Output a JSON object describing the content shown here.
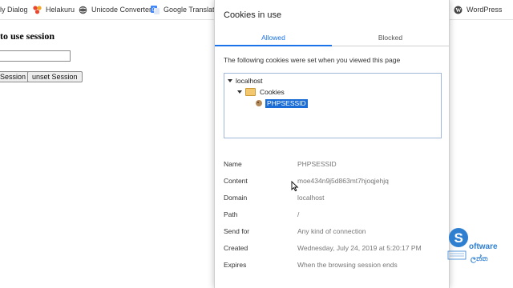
{
  "bookmarks": {
    "items": [
      {
        "label": "ly Dialog"
      },
      {
        "label": "Helakuru"
      },
      {
        "label": "Unicode Converter"
      },
      {
        "label": "Google Translate"
      }
    ],
    "right_item": {
      "label": "WordPress"
    }
  },
  "page": {
    "heading": "to use session",
    "input_value": "",
    "buttons": [
      "Session",
      "unset Session"
    ]
  },
  "dialog": {
    "title": "Cookies in use",
    "tabs": [
      "Allowed",
      "Blocked"
    ],
    "active_tab": "Allowed",
    "intro": "The following cookies were set when you viewed this page",
    "tree": {
      "root": "localhost",
      "folder": "Cookies",
      "cookie": "PHPSESSID"
    },
    "details": [
      {
        "label": "Name",
        "value": "PHPSESSID"
      },
      {
        "label": "Content",
        "value": "moe434n9j5d863mt7hjoqjehjq"
      },
      {
        "label": "Domain",
        "value": "localhost"
      },
      {
        "label": "Path",
        "value": "/"
      },
      {
        "label": "Send for",
        "value": "Any kind of connection"
      },
      {
        "label": "Created",
        "value": "Wednesday, July 24, 2019 at 5:20:17 PM"
      },
      {
        "label": "Expires",
        "value": "When the browsing session ends"
      }
    ]
  },
  "watermark": {
    "brand": "oftware",
    "brand_initial": "S",
    "subtitle": "ලන්ත"
  },
  "colors": {
    "accent": "#1a73e8",
    "selection": "#1a6dd6",
    "logo_blue": "#2f7fd1"
  }
}
